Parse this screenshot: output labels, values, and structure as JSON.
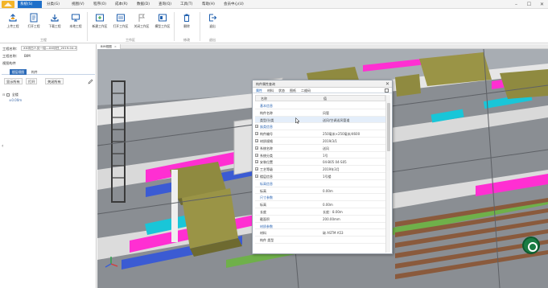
{
  "menu": {
    "items": [
      {
        "label": "系统(S)",
        "active": true
      },
      {
        "label": "分类(G)"
      },
      {
        "label": "视图(V)"
      },
      {
        "label": "程序(O)"
      },
      {
        "label": "成本(R)"
      },
      {
        "label": "数据(D)"
      },
      {
        "label": "查询(Q)"
      },
      {
        "label": "工具(T)"
      },
      {
        "label": "帮助(H)"
      },
      {
        "label": "会员中心(U)"
      }
    ]
  },
  "window": {
    "minimize": "–",
    "maximize": "☐",
    "close": "✕"
  },
  "ribbon": {
    "groups": [
      {
        "label": "工程",
        "buttons": [
          {
            "label": "上传工程",
            "icon": "upload-icon"
          },
          {
            "label": "打开工程",
            "icon": "open-file-icon"
          },
          {
            "label": "下载工程",
            "icon": "download-icon"
          },
          {
            "label": "本地工程",
            "icon": "local-project-icon"
          }
        ]
      },
      {
        "label": "工作区",
        "buttons": [
          {
            "label": "新建工作区",
            "icon": "new-workspace-icon"
          },
          {
            "label": "打开工作区",
            "icon": "open-workspace-icon"
          },
          {
            "label": "关闭工作区",
            "icon": "flag-icon"
          },
          {
            "label": "模型工作区",
            "icon": "model-workspace-icon"
          }
        ]
      },
      {
        "label": "修改",
        "buttons": [
          {
            "label": "删除",
            "icon": "trash-icon"
          }
        ]
      },
      {
        "label": "退出",
        "buttons": [
          {
            "label": "退出",
            "icon": "exit-icon"
          }
        ]
      }
    ]
  },
  "left_panel": {
    "project_label": "工程名称：",
    "project_value": "XX项目人员一组—XX项目_2019-04-2 ▾",
    "name_label": "工程名称：",
    "name_value": "BIM",
    "view_label": "视图构件",
    "tabs": [
      "楼层视图",
      "构件"
    ],
    "buttons": [
      "显示所有",
      "打开",
      "关闭所有"
    ],
    "tree": {
      "root": "全楼",
      "child": "±0.00m"
    },
    "collapse_glyph": "‹"
  },
  "viewport": {
    "tab_label": "BIM视图",
    "tab_close": "×"
  },
  "properties": {
    "title": "构件属性查询",
    "close_glyph": "✕",
    "tabs": [
      "属性",
      "材料",
      "状态",
      "图纸",
      "二维码"
    ],
    "header": {
      "name": "名称",
      "value": "值"
    },
    "rows": [
      {
        "name": "基本信息",
        "value": "",
        "group": true
      },
      {
        "name": "构件名称",
        "value": "风管"
      },
      {
        "name": "类型/分类",
        "value": "送风/空调送风管道",
        "selected": true
      },
      {
        "name": "族类信息",
        "value": "",
        "group": true,
        "expand": true
      },
      {
        "name": "构件编号",
        "value": "250毫米×250毫米/4600",
        "expand": true
      },
      {
        "name": "材质规格",
        "value": "2019/3/1",
        "expand": true
      },
      {
        "name": "系统名称",
        "value": "送风",
        "expand": true
      },
      {
        "name": "系统分类",
        "value": "1号",
        "expand": true
      },
      {
        "name": "安装位置",
        "value": "04-B05 04-S05",
        "expand": true
      },
      {
        "name": "工艺等级",
        "value": "2019年3月",
        "expand": true
      },
      {
        "name": "楼层信息",
        "value": "1号楼",
        "expand": true
      },
      {
        "name": "标高信息",
        "value": "",
        "group": true
      },
      {
        "name": "标高",
        "value": "0.00m"
      },
      {
        "name": "尺寸参数",
        "value": "",
        "group": true
      },
      {
        "name": "标高",
        "value": "0.00m"
      },
      {
        "name": "长度",
        "value": "长度：8.00m"
      },
      {
        "name": "截面积",
        "value": "200.00mm"
      },
      {
        "name": "材质参数",
        "value": "",
        "group": true
      },
      {
        "name": "材料",
        "value": "碳 ASTM A53"
      },
      {
        "name": "构件   类型",
        "value": ""
      }
    ]
  },
  "colors": {
    "accent": "#1e6fc9",
    "duct_olive": "#8f8a40",
    "duct_magenta": "#ff2fd2",
    "pipe_cyan": "#19c6d8",
    "pipe_green": "#6fb04a",
    "wall_gray": "#e2e2e2"
  }
}
